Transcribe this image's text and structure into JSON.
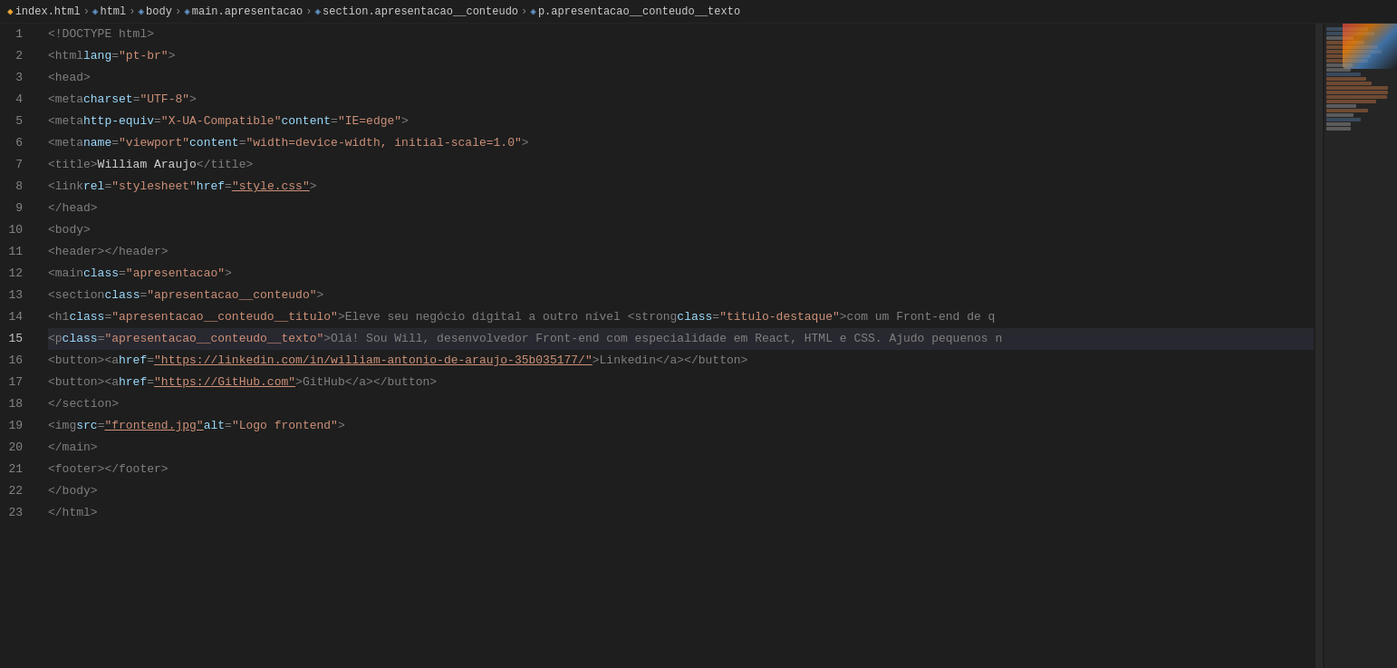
{
  "breadcrumb": {
    "items": [
      {
        "label": "index.html",
        "type": "file",
        "icon": "◆"
      },
      {
        "label": "html",
        "type": "element",
        "icon": "◈"
      },
      {
        "label": "body",
        "type": "element",
        "icon": "◈"
      },
      {
        "label": "main.apresentacao",
        "type": "element",
        "icon": "◈"
      },
      {
        "label": "section.apresentacao__conteudo",
        "type": "element",
        "icon": "◈"
      },
      {
        "label": "p.apresentacao__conteudo__texto",
        "type": "element",
        "icon": "◈"
      }
    ]
  },
  "lines": [
    {
      "num": 1,
      "tokens": [
        {
          "t": "t-gray",
          "v": "<!DOCTYPE html>"
        }
      ]
    },
    {
      "num": 2,
      "tokens": [
        {
          "t": "t-gray",
          "v": "<html "
        },
        {
          "t": "t-attr",
          "v": "lang"
        },
        {
          "t": "t-gray",
          "v": "="
        },
        {
          "t": "t-string",
          "v": "\"pt-br\""
        },
        {
          "t": "t-gray",
          "v": ">"
        }
      ]
    },
    {
      "num": 3,
      "tokens": [
        {
          "t": "t-gray",
          "v": "   <head>"
        }
      ]
    },
    {
      "num": 4,
      "tokens": [
        {
          "t": "t-gray",
          "v": "       <meta "
        },
        {
          "t": "t-attr",
          "v": "charset"
        },
        {
          "t": "t-gray",
          "v": "="
        },
        {
          "t": "t-string",
          "v": "\"UTF-8\""
        },
        {
          "t": "t-gray",
          "v": ">"
        }
      ]
    },
    {
      "num": 5,
      "tokens": [
        {
          "t": "t-gray",
          "v": "       <meta "
        },
        {
          "t": "t-attr",
          "v": "http-equiv"
        },
        {
          "t": "t-gray",
          "v": "="
        },
        {
          "t": "t-string",
          "v": "\"X-UA-Compatible\""
        },
        {
          "t": "t-gray",
          "v": " "
        },
        {
          "t": "t-attr",
          "v": "content"
        },
        {
          "t": "t-gray",
          "v": "="
        },
        {
          "t": "t-string",
          "v": "\"IE=edge\""
        },
        {
          "t": "t-gray",
          "v": ">"
        }
      ]
    },
    {
      "num": 6,
      "tokens": [
        {
          "t": "t-gray",
          "v": "       <meta "
        },
        {
          "t": "t-attr",
          "v": "name"
        },
        {
          "t": "t-gray",
          "v": "="
        },
        {
          "t": "t-string",
          "v": "\"viewport\""
        },
        {
          "t": "t-gray",
          "v": " "
        },
        {
          "t": "t-attr",
          "v": "content"
        },
        {
          "t": "t-gray",
          "v": "="
        },
        {
          "t": "t-string",
          "v": "\"width=device-width, initial-scale=1.0\""
        },
        {
          "t": "t-gray",
          "v": ">"
        }
      ]
    },
    {
      "num": 7,
      "tokens": [
        {
          "t": "t-gray",
          "v": "       <title>"
        },
        {
          "t": "t-plain",
          "v": "William Araujo"
        },
        {
          "t": "t-gray",
          "v": "</title>"
        }
      ]
    },
    {
      "num": 8,
      "tokens": [
        {
          "t": "t-gray",
          "v": "       <link "
        },
        {
          "t": "t-attr",
          "v": "rel"
        },
        {
          "t": "t-gray",
          "v": "="
        },
        {
          "t": "t-string",
          "v": "\"stylesheet\""
        },
        {
          "t": "t-gray",
          "v": " "
        },
        {
          "t": "t-attr",
          "v": "href"
        },
        {
          "t": "t-gray",
          "v": "="
        },
        {
          "t": "t-underline t-string",
          "v": "\"style.css\""
        },
        {
          "t": "t-gray",
          "v": ">"
        }
      ]
    },
    {
      "num": 9,
      "tokens": [
        {
          "t": "t-gray",
          "v": "   </head>"
        }
      ]
    },
    {
      "num": 10,
      "tokens": [
        {
          "t": "t-gray",
          "v": "   <body>"
        }
      ]
    },
    {
      "num": 11,
      "tokens": [
        {
          "t": "t-gray",
          "v": "       <header></header>"
        }
      ]
    },
    {
      "num": 12,
      "tokens": [
        {
          "t": "t-gray",
          "v": "       <main "
        },
        {
          "t": "t-attr",
          "v": "class"
        },
        {
          "t": "t-gray",
          "v": "="
        },
        {
          "t": "t-string",
          "v": "\"apresentacao\""
        },
        {
          "t": "t-gray",
          "v": ">"
        }
      ]
    },
    {
      "num": 13,
      "tokens": [
        {
          "t": "t-gray",
          "v": "           <section "
        },
        {
          "t": "t-attr",
          "v": "class"
        },
        {
          "t": "t-gray",
          "v": "="
        },
        {
          "t": "t-string",
          "v": "\"apresentacao__conteudo\""
        },
        {
          "t": "t-gray",
          "v": ">"
        }
      ]
    },
    {
      "num": 14,
      "tokens": [
        {
          "t": "t-gray",
          "v": "               <h1 "
        },
        {
          "t": "t-attr",
          "v": "class"
        },
        {
          "t": "t-gray",
          "v": "="
        },
        {
          "t": "t-string",
          "v": "\"apresentacao__conteudo__titulo\""
        },
        {
          "t": "t-gray",
          "v": ">Eleve seu negócio digital a outro nível <strong "
        },
        {
          "t": "t-attr",
          "v": "class"
        },
        {
          "t": "t-gray",
          "v": "="
        },
        {
          "t": "t-string",
          "v": "\"titulo-destaque\""
        },
        {
          "t": "t-gray",
          "v": ">com um Front-end de q"
        }
      ]
    },
    {
      "num": 15,
      "tokens": [
        {
          "t": "t-gray",
          "v": "               <p "
        },
        {
          "t": "t-attr",
          "v": "class"
        },
        {
          "t": "t-gray",
          "v": "="
        },
        {
          "t": "t-string",
          "v": "\"apresentacao__conteudo__texto\""
        },
        {
          "t": "t-gray",
          "v": ">Olá! Sou Will, desenvolvedor Front-end com especialidade em React, HTML e CSS. Ajudo pequenos n"
        }
      ]
    },
    {
      "num": 16,
      "tokens": [
        {
          "t": "t-gray",
          "v": "               <button><a "
        },
        {
          "t": "t-attr",
          "v": "href"
        },
        {
          "t": "t-gray",
          "v": "="
        },
        {
          "t": "t-underline t-string",
          "v": "\"https://linkedin.com/in/william-antonio-de-araujo-35b035177/\""
        },
        {
          "t": "t-gray",
          "v": ">Linkedin</a></button>"
        }
      ]
    },
    {
      "num": 17,
      "tokens": [
        {
          "t": "t-gray",
          "v": "               <button><a "
        },
        {
          "t": "t-attr",
          "v": "href"
        },
        {
          "t": "t-gray",
          "v": "="
        },
        {
          "t": "t-underline t-string",
          "v": "\"https://GitHub.com\""
        },
        {
          "t": "t-gray",
          "v": ">GitHub</a></button>"
        }
      ]
    },
    {
      "num": 18,
      "tokens": [
        {
          "t": "t-gray",
          "v": "           </section>"
        }
      ]
    },
    {
      "num": 19,
      "tokens": [
        {
          "t": "t-gray",
          "v": "           <img "
        },
        {
          "t": "t-attr",
          "v": "src"
        },
        {
          "t": "t-gray",
          "v": "="
        },
        {
          "t": "t-underline t-string",
          "v": "\"frontend.jpg\""
        },
        {
          "t": "t-gray",
          "v": " "
        },
        {
          "t": "t-attr",
          "v": "alt"
        },
        {
          "t": "t-gray",
          "v": "="
        },
        {
          "t": "t-string",
          "v": "\"Logo frontend\""
        },
        {
          "t": "t-gray",
          "v": ">"
        }
      ]
    },
    {
      "num": 20,
      "tokens": [
        {
          "t": "t-gray",
          "v": "       </main>"
        }
      ]
    },
    {
      "num": 21,
      "tokens": [
        {
          "t": "t-gray",
          "v": "       <footer></footer>"
        }
      ]
    },
    {
      "num": 22,
      "tokens": [
        {
          "t": "t-gray",
          "v": "   </body>"
        }
      ]
    },
    {
      "num": 23,
      "tokens": [
        {
          "t": "t-gray",
          "v": "   </html>"
        }
      ]
    }
  ],
  "highlighted_line": 15
}
